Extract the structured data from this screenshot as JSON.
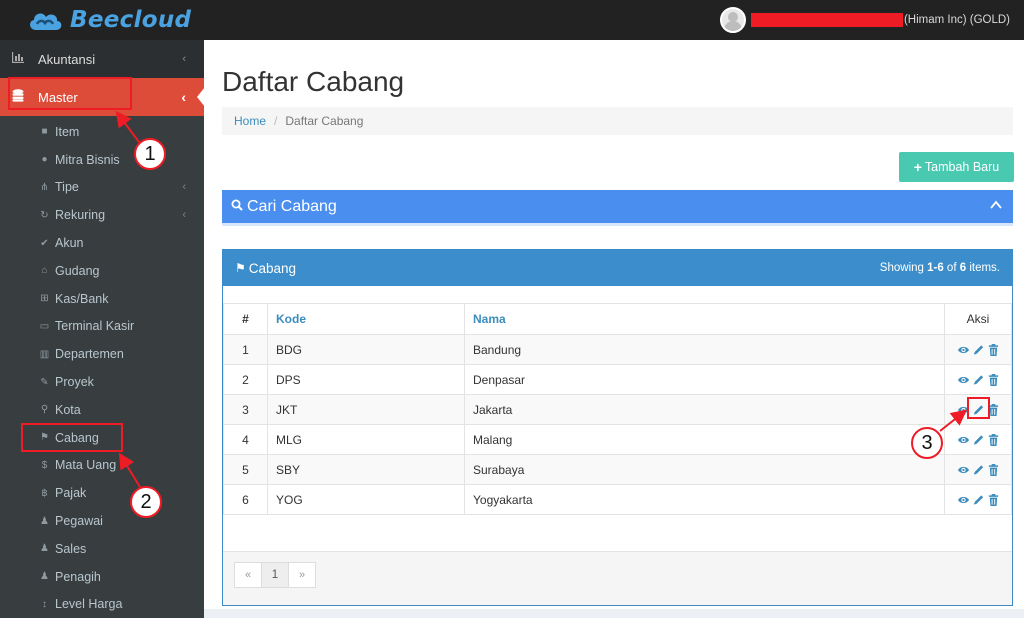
{
  "app": {
    "logo_text": "Beecloud"
  },
  "user": {
    "org": "(Himam Inc) (GOLD)"
  },
  "sidebar": {
    "top_items": [
      {
        "label": "Akuntansi",
        "icon": "bar-chart-icon",
        "has_chevron": true
      },
      {
        "label": "Master",
        "icon": "database-icon",
        "has_chevron": true,
        "active": true
      }
    ],
    "sub_items": [
      {
        "label": "Item",
        "icon": "cube-icon"
      },
      {
        "label": "Mitra Bisnis",
        "icon": "users-icon"
      },
      {
        "label": "Tipe",
        "icon": "sitemap-icon",
        "has_chevron": true
      },
      {
        "label": "Rekuring",
        "icon": "refresh-icon",
        "has_chevron": true
      },
      {
        "label": "Akun",
        "icon": "check-icon"
      },
      {
        "label": "Gudang",
        "icon": "home-icon"
      },
      {
        "label": "Kas/Bank",
        "icon": "bank-icon"
      },
      {
        "label": "Terminal Kasir",
        "icon": "desktop-icon"
      },
      {
        "label": "Departemen",
        "icon": "building-icon"
      },
      {
        "label": "Proyek",
        "icon": "gavel-icon"
      },
      {
        "label": "Kota",
        "icon": "map-marker-icon"
      },
      {
        "label": "Cabang",
        "icon": "flag-icon"
      },
      {
        "label": "Mata Uang",
        "icon": "dollar-icon"
      },
      {
        "label": "Pajak",
        "icon": "bitcoin-icon"
      },
      {
        "label": "Pegawai",
        "icon": "user-icon"
      },
      {
        "label": "Sales",
        "icon": "user-icon"
      },
      {
        "label": "Penagih",
        "icon": "user-icon"
      },
      {
        "label": "Level Harga",
        "icon": "sort-icon"
      }
    ]
  },
  "page": {
    "title": "Daftar Cabang",
    "breadcrumb": {
      "home": "Home",
      "separator": "/",
      "current": "Daftar Cabang"
    },
    "add_button": "Tambah Baru",
    "search_title": "Cari Cabang"
  },
  "panel": {
    "title": "Cabang",
    "summary_prefix": "Showing ",
    "summary_range": "1-6",
    "summary_mid": " of ",
    "summary_total": "6",
    "summary_suffix": " items."
  },
  "table": {
    "headers": {
      "num": "#",
      "kode": "Kode",
      "nama": "Nama",
      "aksi": "Aksi"
    },
    "rows": [
      {
        "num": "1",
        "kode": "BDG",
        "nama": "Bandung"
      },
      {
        "num": "2",
        "kode": "DPS",
        "nama": "Denpasar"
      },
      {
        "num": "3",
        "kode": "JKT",
        "nama": "Jakarta"
      },
      {
        "num": "4",
        "kode": "MLG",
        "nama": "Malang"
      },
      {
        "num": "5",
        "kode": "SBY",
        "nama": "Surabaya"
      },
      {
        "num": "6",
        "kode": "YOG",
        "nama": "Yogyakarta"
      }
    ]
  },
  "pager": {
    "prev": "«",
    "page": "1",
    "next": "»"
  },
  "annotations": {
    "one": "1",
    "two": "2",
    "three": "3"
  },
  "colors": {
    "topbar": "#222222",
    "sidebar": "#2b2f31",
    "active_menu": "#dd4b39",
    "add_button": "#48c9b0",
    "search_bar": "#4a8ff0",
    "panel_header": "#3c8dcb",
    "annotation_red": "#ee1c24"
  }
}
